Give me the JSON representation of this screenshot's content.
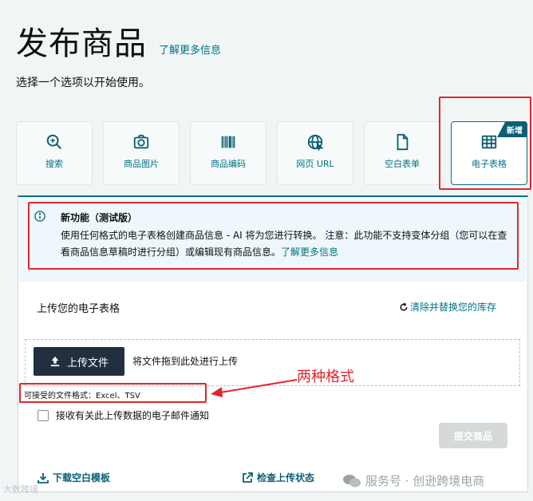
{
  "header": {
    "title": "发布商品",
    "learn_more": "了解更多信息",
    "subtitle": "选择一个选项以开始使用。"
  },
  "options": [
    {
      "label": "搜索",
      "icon": "search-icon"
    },
    {
      "label": "商品图片",
      "icon": "camera-icon"
    },
    {
      "label": "商品编码",
      "icon": "barcode-icon"
    },
    {
      "label": "网页 URL",
      "icon": "globe-icon"
    },
    {
      "label": "空白表单",
      "icon": "document-icon"
    },
    {
      "label": "电子表格",
      "icon": "spreadsheet-icon",
      "badge": "新增",
      "selected": true
    }
  ],
  "alert": {
    "title": "新功能（测试版）",
    "body": "使用任何格式的电子表格创建商品信息 - AI 将为您进行转换。 注意：此功能不支持变体分组（您可以在查看商品信息草稿时进行分组）或编辑现有商品信息。",
    "link": "了解更多信息"
  },
  "upload": {
    "heading": "上传您的电子表格",
    "clear_link": "清除并替换您的库存",
    "button": "上传文件",
    "drag_text": "将文件拖到此处进行上传",
    "formats": "可接受的文件格式：Excel、TSV",
    "checkbox_label": "接收有关此上传数据的电子邮件通知",
    "submit": "提交商品"
  },
  "footer": {
    "download_template": "下载空白模板",
    "check_status": "检查上传状态"
  },
  "annotation": {
    "text": "两种格式"
  },
  "watermark": {
    "left": "大数跨境",
    "right": "服务号 · 创逊跨境电商"
  },
  "colors": {
    "accent": "#007185",
    "dark": "#232f3e",
    "annotation": "#e4252a",
    "alert_bg": "#eef7fb"
  }
}
